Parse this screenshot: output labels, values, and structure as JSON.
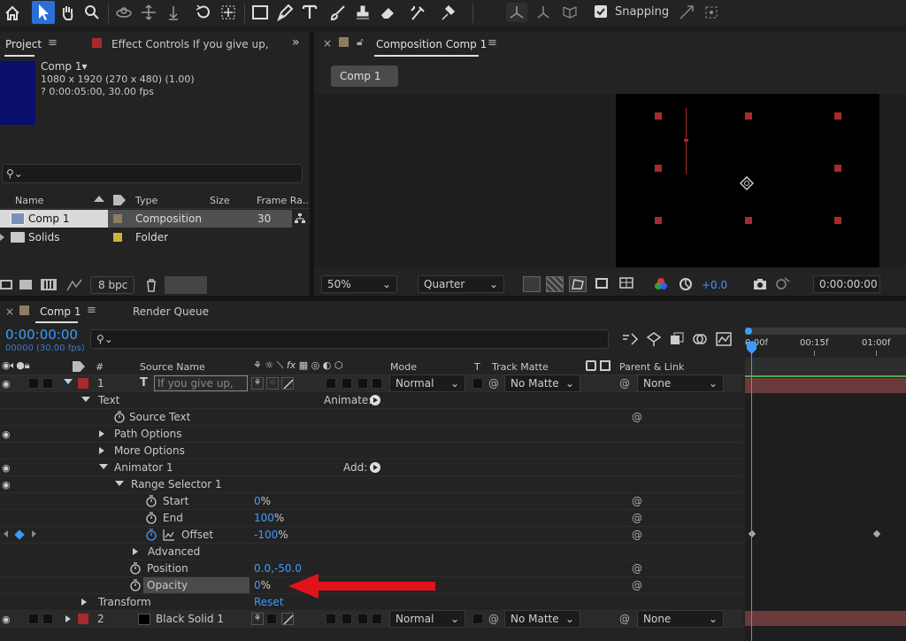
{
  "toolbar": {
    "snapping_label": "Snapping",
    "tools": [
      "home-icon",
      "selection-icon",
      "hand-icon",
      "zoom-icon",
      "orbit-icon",
      "pan-icon",
      "dolly-icon",
      "rotate-icon",
      "anchor-icon",
      "rectangle-icon",
      "pen-icon",
      "type-icon",
      "brush-icon",
      "clone-stamp-icon",
      "eraser-icon",
      "roto-brush-icon",
      "puppet-pin-icon"
    ]
  },
  "project_panel": {
    "tab_project": "Project",
    "tab_effect_controls": "Effect Controls If you give up,",
    "comp_name": "Comp 1",
    "comp_info_line1": "1080 x 1920  (270 x 480) (1.00)",
    "comp_info_line2": "? 0:00:05:00, 30.00 fps",
    "search_placeholder": "",
    "col_name": "Name",
    "col_type": "Type",
    "col_size": "Size",
    "col_frame_rate": "Frame Ra...",
    "items": [
      {
        "name": "Comp 1",
        "type": "Composition",
        "size": "",
        "frame_rate": "30",
        "label_color": "#8b7d5e"
      },
      {
        "name": "Solids",
        "type": "Folder",
        "size": "",
        "frame_rate": "",
        "label_color": "#c8b43c"
      }
    ],
    "bpc_label": "8 bpc"
  },
  "comp_panel": {
    "tab_title": "Composition Comp 1",
    "breadcrumb": "Comp 1",
    "zoom": "50%",
    "resolution": "Quarter",
    "exposure": "+0.0",
    "timecode": "0:00:00:00"
  },
  "timeline": {
    "tab_comp": "Comp 1",
    "tab_render_queue": "Render Queue",
    "current_time": "0:00:00:00",
    "frame_info": "00000 (30.00 fps)",
    "search_placeholder": "",
    "col_num": "#",
    "col_source_name": "Source Name",
    "col_mode": "Mode",
    "col_t": "T",
    "col_track_matte": "Track Matte",
    "col_parent": "Parent & Link",
    "ruler": [
      "0:00f",
      "00:15f",
      "01:00f"
    ],
    "layers": [
      {
        "num": "1",
        "name": "If you give up,",
        "mode": "Normal",
        "matte": "No Matte",
        "parent": "None"
      },
      {
        "num": "2",
        "name": "Black Solid 1",
        "mode": "Normal",
        "matte": "No Matte",
        "parent": "None"
      }
    ],
    "props": {
      "text": "Text",
      "animate": "Animate:",
      "source_text": "Source Text",
      "path_options": "Path Options",
      "more_options": "More Options",
      "animator": "Animator 1",
      "add": "Add:",
      "range_selector": "Range Selector 1",
      "start": "Start",
      "start_val": "0",
      "start_unit": "%",
      "end": "End",
      "end_val": "100",
      "end_unit": "%",
      "offset": "Offset",
      "offset_val": "-100",
      "offset_unit": "%",
      "advanced": "Advanced",
      "position": "Position",
      "position_val": "0.0,-50.0",
      "opacity": "Opacity",
      "opacity_val": "0",
      "opacity_unit": "%",
      "transform": "Transform",
      "reset": "Reset"
    }
  },
  "colors": {
    "accent_blue": "#3d9bff",
    "arrow_red": "#e0131a",
    "layer1_label": "#a82a2a",
    "layer2_label": "#a82a2a"
  }
}
